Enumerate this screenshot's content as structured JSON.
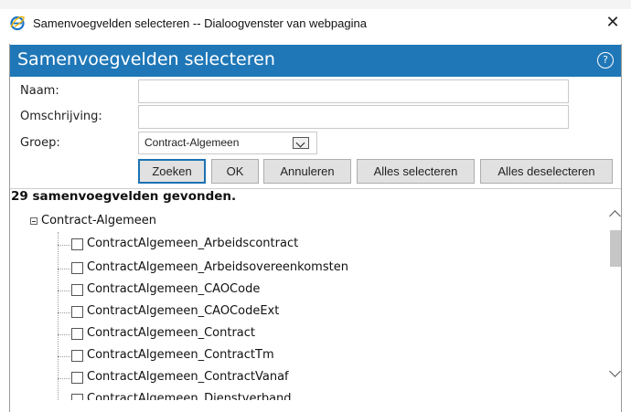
{
  "window": {
    "title": "Samenvoegvelden selecteren -- Dialoogvenster van webpagina",
    "close_glyph": "✕",
    "icon": "ie-icon"
  },
  "header": {
    "title": "Samenvoegvelden selecteren",
    "help_glyph": "?",
    "background_color": "#1f77b7"
  },
  "form": {
    "name_label": "Naam:",
    "name_value": "",
    "description_label": "Omschrijving:",
    "description_value": "",
    "group_label": "Groep:",
    "group_selected": "Contract-Algemeen"
  },
  "buttons": {
    "search": "Zoeken",
    "ok": "OK",
    "cancel": "Annuleren",
    "select_all": "Alles selecteren",
    "deselect_all": "Alles deselecteren"
  },
  "results": {
    "summary": "29 samenvoegvelden gevonden.",
    "root": {
      "label": "Contract-Algemeen",
      "expanded": true
    },
    "items": [
      {
        "label": "ContractAlgemeen_Arbeidscontract",
        "checked": false
      },
      {
        "label": "ContractAlgemeen_Arbeidsovereenkomsten",
        "checked": false
      },
      {
        "label": "ContractAlgemeen_CAOCode",
        "checked": false
      },
      {
        "label": "ContractAlgemeen_CAOCodeExt",
        "checked": false
      },
      {
        "label": "ContractAlgemeen_Contract",
        "checked": false
      },
      {
        "label": "ContractAlgemeen_ContractTm",
        "checked": false
      },
      {
        "label": "ContractAlgemeen_ContractVanaf",
        "checked": false
      },
      {
        "label": "ContractAlgemeen_Dienstverband",
        "checked": false
      }
    ]
  }
}
